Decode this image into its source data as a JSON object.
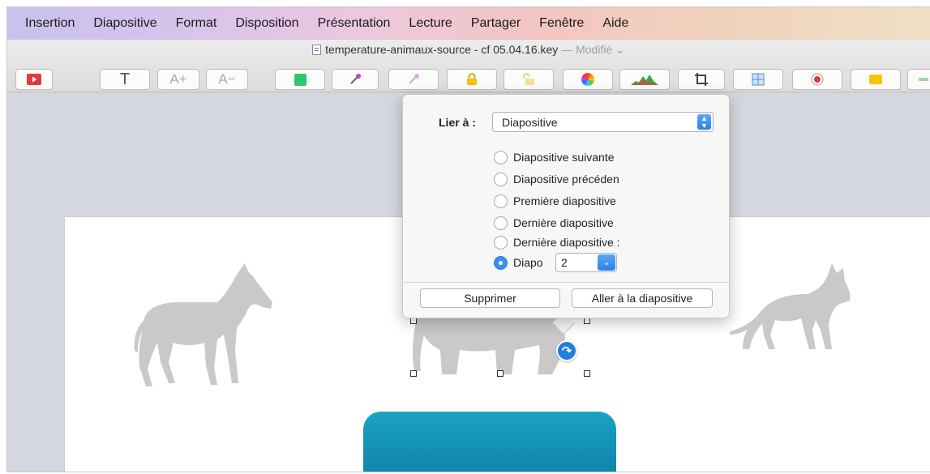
{
  "menubar": {
    "items": [
      "Insertion",
      "Diapositive",
      "Format",
      "Disposition",
      "Présentation",
      "Lecture",
      "Partager",
      "Fenêtre",
      "Aide"
    ]
  },
  "window": {
    "document_title": "temperature-animaux-source - cf 05.04.16.key",
    "separator": "—",
    "status": "Modifié ⌄"
  },
  "toolbar": {
    "icons": [
      "play-icon",
      "text-icon",
      "font-bigger-icon",
      "font-smaller-icon",
      "shape-icon",
      "eyedropper-icon",
      "eyedropper-disabled-icon",
      "lock-icon",
      "unlock-icon",
      "color-wheel-icon",
      "adjust-image-icon",
      "crop-icon",
      "mask-icon",
      "record-icon",
      "comment-icon",
      "share-icon"
    ],
    "text_label": "T",
    "font_bigger_label": "A+",
    "font_smaller_label": "A−"
  },
  "link_popover": {
    "link_to_label": "Lier à :",
    "link_to_value": "Diapositive",
    "options": [
      {
        "label": "Diapositive suivante",
        "selected": false
      },
      {
        "label": "Diapositive précéden",
        "selected": false
      },
      {
        "label": "Première diapositive",
        "selected": false
      },
      {
        "label": "Dernière diapositive",
        "selected": false
      },
      {
        "label": "Dernière diapositive :",
        "selected": false
      },
      {
        "label": "Diapo",
        "selected": true
      }
    ],
    "slide_number": "2",
    "remove_button": "Supprimer",
    "goto_button": "Aller à la diapositive"
  },
  "colors": {
    "accent": "#2f86ee",
    "slide_teal": "#1697b9",
    "silhouette": "#c9c9c9",
    "record_red": "#e23a3a"
  }
}
